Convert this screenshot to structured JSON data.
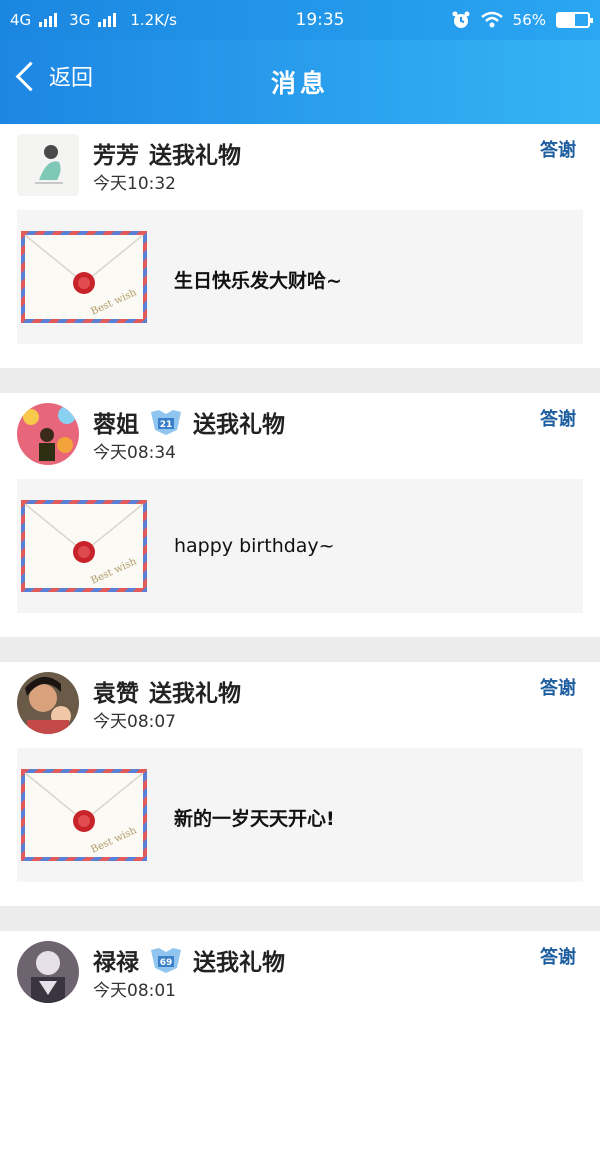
{
  "status_bar": {
    "network1": "4G",
    "network2": "3G",
    "speed": "1.2K/s",
    "time": "19:35",
    "battery_percent": "56%",
    "battery_level": 0.56
  },
  "header": {
    "back_label": "返回",
    "title": "消息"
  },
  "colors": {
    "header_gradient_start": "#1d86e3",
    "header_gradient_end": "#35b4f5",
    "thanks_link": "#1f5fa0",
    "divider": "#ececec",
    "gift_box_bg": "#f5f5f5"
  },
  "messages": [
    {
      "name": "芳芳",
      "action": "送我礼物",
      "time": "今天10:32",
      "thanks_label": "答谢",
      "gift_message": "生日快乐发大财哈~",
      "vip_level": ""
    },
    {
      "name": "蓉姐",
      "action": "送我礼物",
      "time": "今天08:34",
      "thanks_label": "答谢",
      "gift_message": "happy birthday~",
      "vip_level": "21"
    },
    {
      "name": "袁赞",
      "action": "送我礼物",
      "time": "今天08:07",
      "thanks_label": "答谢",
      "gift_message": "新的一岁天天开心!",
      "vip_level": ""
    },
    {
      "name": "禄禄",
      "action": "送我礼物",
      "time": "今天08:01",
      "thanks_label": "答谢",
      "gift_message": "",
      "vip_level": "69"
    }
  ],
  "envelope_stamp_text": "Best wish"
}
